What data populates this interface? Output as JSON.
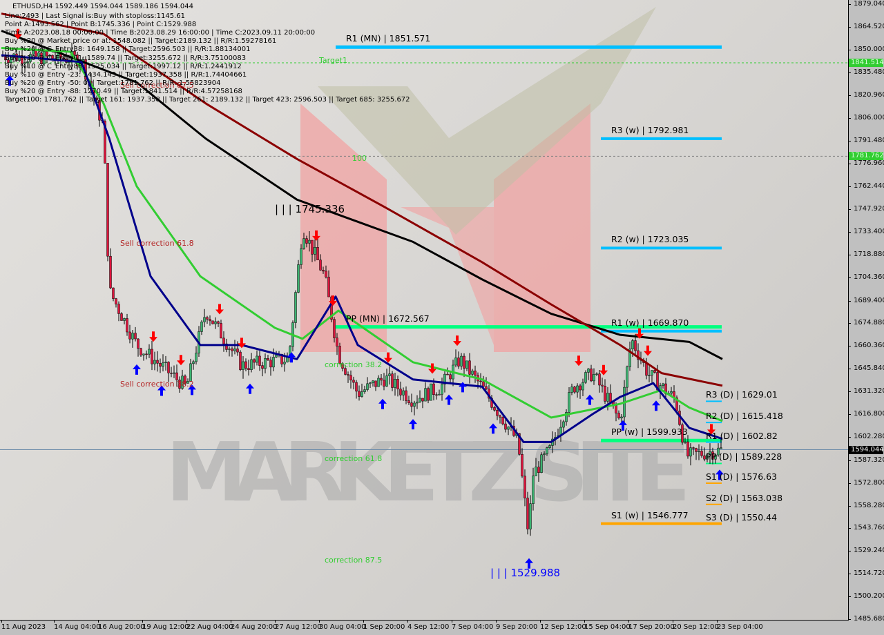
{
  "header": {
    "symbol_line": "ETHUSD,H4  1592.449 1594.044 1589.186 1594.044",
    "info_lines": [
      "Line:2493 | Last Signal is:Buy with stoploss:1145.61",
      "Point A:1493.562 | Point B:1745.336 | Point C:1529.988",
      "Time A:2023.08.18 00:00:00 | Time B:2023.08.29 16:00:00 | Time C:2023.09.11 20:00:00",
      "Buy %20 @ Market price or at: 1548.082 || Target:2189.132 || R/R:1.59278161",
      "Buy %20 @ C_Entry38: 1649.158 || Target:2596.503 || R/R:1.88134001",
      "Buy %10 @ C_Entry61: 1589.74 || Target:3255.672 || R/R:3.75100083",
      "Buy %10 @ C_Entry88: 1525.034 || Target:1997.12 || R/R:1.2441912",
      "Buy %10 @ Entry -23: 1434.143 || Target:1937.358 || R/R:1.74404661",
      "Buy %20 @ Entry -50: 0 || Target:1781.762 || R/R:-1.55823904",
      "Buy %20 @ Entry -88: 1270.49 || Target:1841.514 || R/R:4.57258168",
      "Target100: 1781.762 || Target 161: 1937.358 || Target 261: 2189.132 || Target 423: 2596.503 || Target 685: 3255.672"
    ]
  },
  "watermark": "MARKETZ SITE",
  "colors": {
    "black_ma": "#000000",
    "maroon_ma": "#8b0000",
    "green_ma": "#32cd32",
    "navy_ma": "#00008b",
    "level_blue": "#00bfff",
    "level_green": "#00ff7f",
    "level_orange": "#ffa500",
    "bull": "#3cb371",
    "bear": "#dc143c",
    "buy_arrow": "#0000ff",
    "sell_arrow": "#ff0000"
  },
  "chart_data": {
    "type": "candlestick",
    "symbol": "ETHUSD",
    "timeframe": "H4",
    "ylim": [
      1485.68,
      1879.04
    ],
    "y_ticks": [
      "1879.040",
      "1864.520",
      "1850.000",
      "1835.480",
      "1820.960",
      "1806.000",
      "1791.480",
      "1776.960",
      "1762.440",
      "1747.920",
      "1733.400",
      "1718.880",
      "1704.360",
      "1689.400",
      "1674.880",
      "1660.360",
      "1645.840",
      "1631.320",
      "1616.800",
      "1602.280",
      "1587.320",
      "1572.800",
      "1558.280",
      "1543.760",
      "1529.240",
      "1514.720",
      "1500.200",
      "1485.680"
    ],
    "x_ticks": [
      {
        "label": "11 Aug 2023",
        "t": "2023-08-11T00:00"
      },
      {
        "label": "14 Aug 04:00",
        "t": "2023-08-14T04:00"
      },
      {
        "label": "16 Aug 20:00",
        "t": "2023-08-16T20:00"
      },
      {
        "label": "19 Aug 12:00",
        "t": "2023-08-19T12:00"
      },
      {
        "label": "22 Aug 04:00",
        "t": "2023-08-22T04:00"
      },
      {
        "label": "24 Aug 20:00",
        "t": "2023-08-24T20:00"
      },
      {
        "label": "27 Aug 12:00",
        "t": "2023-08-27T12:00"
      },
      {
        "label": "30 Aug 04:00",
        "t": "2023-08-30T04:00"
      },
      {
        "label": "1 Sep 20:00",
        "t": "2023-09-01T20:00"
      },
      {
        "label": "4 Sep 12:00",
        "t": "2023-09-04T12:00"
      },
      {
        "label": "7 Sep 04:00",
        "t": "2023-09-07T04:00"
      },
      {
        "label": "9 Sep 20:00",
        "t": "2023-09-09T20:00"
      },
      {
        "label": "12 Sep 12:00",
        "t": "2023-09-12T12:00"
      },
      {
        "label": "15 Sep 04:00",
        "t": "2023-09-15T04:00"
      },
      {
        "label": "17 Sep 20:00",
        "t": "2023-09-17T20:00"
      },
      {
        "label": "20 Sep 12:00",
        "t": "2023-09-20T12:00"
      },
      {
        "label": "23 Sep 04:00",
        "t": "2023-09-23T04:00"
      }
    ],
    "current_price": "1594.044",
    "price_tags": [
      {
        "value": "1841.514",
        "color": "#32cd32"
      },
      {
        "value": "1781.762",
        "color": "#32cd32"
      }
    ],
    "close": [
      [
        "2023-08-11T00:00",
        1846
      ],
      [
        "2023-08-15T20:00",
        1844
      ],
      [
        "2023-08-17T04:00",
        1800
      ],
      [
        "2023-08-17T12:00",
        1696
      ],
      [
        "2023-08-19T04:00",
        1661
      ],
      [
        "2023-08-22T04:00",
        1634
      ],
      [
        "2023-08-23T08:00",
        1683
      ],
      [
        "2023-08-25T12:00",
        1648
      ],
      [
        "2023-08-28T08:00",
        1652
      ],
      [
        "2023-08-29T04:00",
        1736
      ],
      [
        "2023-08-30T12:00",
        1705
      ],
      [
        "2023-08-31T08:00",
        1655
      ],
      [
        "2023-09-01T12:00",
        1630
      ],
      [
        "2023-09-03T04:00",
        1640
      ],
      [
        "2023-09-04T20:00",
        1626
      ],
      [
        "2023-09-06T12:00",
        1634
      ],
      [
        "2023-09-07T16:00",
        1652
      ],
      [
        "2023-09-09T00:00",
        1634
      ],
      [
        "2023-09-11T04:00",
        1599
      ],
      [
        "2023-09-11T20:00",
        1537
      ],
      [
        "2023-09-12T00:00",
        1577
      ],
      [
        "2023-09-13T04:00",
        1595
      ],
      [
        "2023-09-14T12:00",
        1634
      ],
      [
        "2023-09-15T16:00",
        1643
      ],
      [
        "2023-09-17T08:00",
        1612
      ],
      [
        "2023-09-18T00:00",
        1665
      ],
      [
        "2023-09-19T00:00",
        1643
      ],
      [
        "2023-09-20T16:00",
        1626
      ],
      [
        "2023-09-21T08:00",
        1590
      ],
      [
        "2023-09-23T12:00",
        1594
      ]
    ],
    "moving_averages": [
      {
        "color": "#000000",
        "points": [
          [
            "2023-08-11T00:00",
            1862
          ],
          [
            "2023-08-19T04:00",
            1829
          ],
          [
            "2023-08-23T08:00",
            1793
          ],
          [
            "2023-08-28T20:00",
            1754
          ],
          [
            "2023-09-04T20:00",
            1727
          ],
          [
            "2023-09-09T00:00",
            1703
          ],
          [
            "2023-09-13T04:00",
            1681
          ],
          [
            "2023-09-17T08:00",
            1667.5
          ],
          [
            "2023-09-21T12:00",
            1663
          ],
          [
            "2023-09-23T12:00",
            1652
          ]
        ]
      },
      {
        "color": "#8b0000",
        "points": [
          [
            "2023-08-11T00:00",
            1873
          ],
          [
            "2023-08-17T04:00",
            1860
          ],
          [
            "2023-08-23T08:00",
            1815.5
          ],
          [
            "2023-08-28T20:00",
            1780
          ],
          [
            "2023-09-03T04:00",
            1749
          ],
          [
            "2023-09-09T00:00",
            1714
          ],
          [
            "2023-09-13T04:00",
            1687
          ],
          [
            "2023-09-17T08:00",
            1661
          ],
          [
            "2023-09-19T20:00",
            1643
          ],
          [
            "2023-09-23T12:00",
            1635
          ]
        ]
      },
      {
        "color": "#32cd32",
        "points": [
          [
            "2023-08-11T00:00",
            1851
          ],
          [
            "2023-08-15T04:00",
            1848.6
          ],
          [
            "2023-08-17T04:00",
            1815.5
          ],
          [
            "2023-08-19T04:00",
            1762.5
          ],
          [
            "2023-08-23T00:00",
            1705
          ],
          [
            "2023-08-27T12:00",
            1672
          ],
          [
            "2023-08-29T04:00",
            1665
          ],
          [
            "2023-08-31T08:00",
            1683
          ],
          [
            "2023-09-04T20:00",
            1650
          ],
          [
            "2023-09-09T00:00",
            1639
          ],
          [
            "2023-09-13T04:00",
            1614.6
          ],
          [
            "2023-09-17T08:00",
            1623.4
          ],
          [
            "2023-09-19T20:00",
            1632.2
          ],
          [
            "2023-09-21T12:00",
            1621
          ],
          [
            "2023-09-23T12:00",
            1612.4
          ]
        ]
      },
      {
        "color": "#00008b",
        "points": [
          [
            "2023-08-11T00:00",
            1846.4
          ],
          [
            "2023-08-15T20:00",
            1842
          ],
          [
            "2023-08-17T12:00",
            1793.4
          ],
          [
            "2023-08-20T00:00",
            1705
          ],
          [
            "2023-08-23T00:00",
            1661
          ],
          [
            "2023-08-25T12:00",
            1661
          ],
          [
            "2023-08-28T20:00",
            1652
          ],
          [
            "2023-08-31T04:00",
            1692
          ],
          [
            "2023-09-01T12:00",
            1661
          ],
          [
            "2023-09-04T20:00",
            1639
          ],
          [
            "2023-09-09T00:00",
            1634.4
          ],
          [
            "2023-09-11T12:00",
            1599
          ],
          [
            "2023-09-13T04:00",
            1599
          ],
          [
            "2023-09-15T16:00",
            1616.8
          ],
          [
            "2023-09-17T08:00",
            1627.8
          ],
          [
            "2023-09-19T08:00",
            1636.6
          ],
          [
            "2023-09-21T12:00",
            1608
          ],
          [
            "2023-09-23T12:00",
            1601
          ]
        ]
      }
    ],
    "levels": [
      {
        "label": "R1 (MN) | 1851.571",
        "value": 1851.571,
        "color": "#00bfff",
        "from": "2023-08-31T04:00"
      },
      {
        "label": "R3 (w) | 1792.981",
        "value": 1792.981,
        "color": "#00bfff",
        "from": "2023-09-16T04:00"
      },
      {
        "label": "R2 (w) | 1723.035",
        "value": 1723.035,
        "color": "#00bfff",
        "from": "2023-09-16T04:00"
      },
      {
        "label": "PP (MN) | 1672.567",
        "value": 1672.567,
        "color": "#00ff7f",
        "from": "2023-08-31T04:00"
      },
      {
        "label": "R1 (w) | 1669.870",
        "value": 1669.87,
        "color": "#00bfff",
        "from": "2023-09-16T04:00"
      },
      {
        "label": "PP (w) | 1599.933",
        "value": 1599.933,
        "color": "#00ff7f",
        "from": "2023-09-16T04:00"
      },
      {
        "label": "S1 (w) | 1546.777",
        "value": 1546.777,
        "color": "#ffa500",
        "from": "2023-09-16T04:00"
      },
      {
        "label": "R3 (D) | 1629.01",
        "value": 1629.01,
        "color": "#00bfff",
        "from": "2023-09-22T12:00"
      },
      {
        "label": "R2 (D) | 1615.418",
        "value": 1615.418,
        "color": "#00bfff",
        "from": "2023-09-22T12:00"
      },
      {
        "label": "R1 (D) | 1602.82",
        "value": 1602.82,
        "color": "#00bfff",
        "from": "2023-09-22T12:00"
      },
      {
        "label": "PP (D) | 1589.228",
        "value": 1589.228,
        "color": "#00ff7f",
        "from": "2023-09-22T12:00"
      },
      {
        "label": "S1 (D) | 1576.63",
        "value": 1576.63,
        "color": "#ffa500",
        "from": "2023-09-22T12:00"
      },
      {
        "label": "S2 (D) | 1563.038",
        "value": 1563.038,
        "color": "#ffa500",
        "from": "2023-09-22T12:00"
      },
      {
        "label": "S3 (D) | 1550.44",
        "value": 1550.44,
        "color": "#ffa500",
        "from": "2023-09-22T12:00"
      }
    ],
    "target_lines": [
      {
        "value": 1841.514,
        "color": "#32cd32"
      },
      {
        "value": 1781.762,
        "color": "#808080"
      }
    ],
    "annotations": [
      {
        "text": "Target1",
        "color": "#32cd32",
        "t": "2023-08-30T04:00",
        "value": 1843
      },
      {
        "text": "| | | 1745.336",
        "color": "#000000",
        "t": "2023-08-27T12:00",
        "value": 1749
      },
      {
        "text": "100",
        "color": "#32cd32",
        "t": "2023-09-01T04:00",
        "value": 1780
      },
      {
        "text": "Sell correction 87.5",
        "color": "#b22222",
        "t": "2023-08-18T04:00",
        "value": 1827
      },
      {
        "text": "Sell correction 61.8",
        "color": "#b22222",
        "t": "2023-08-18T04:00",
        "value": 1726
      },
      {
        "text": "Sell correction 38.2",
        "color": "#b22222",
        "t": "2023-08-18T04:00",
        "value": 1636
      },
      {
        "text": "correction 38.2",
        "color": "#32cd32",
        "t": "2023-08-30T12:00",
        "value": 1648
      },
      {
        "text": "correction 61.8",
        "color": "#32cd32",
        "t": "2023-08-30T12:00",
        "value": 1588
      },
      {
        "text": "correction 87.5",
        "color": "#32cd32",
        "t": "2023-08-30T12:00",
        "value": 1523
      },
      {
        "text": "| | | 1529.988",
        "color": "#0000ff",
        "t": "2023-09-09T12:00",
        "value": 1516
      }
    ],
    "buy_signals": [
      "2023-08-11T12:00",
      "2023-08-19T04:00",
      "2023-08-20T16:00",
      "2023-08-22T12:00",
      "2023-08-26T00:00",
      "2023-08-28T12:00",
      "2023-09-03T00:00",
      "2023-09-04T20:00",
      "2023-09-07T00:00",
      "2023-09-07T20:00",
      "2023-09-09T16:00",
      "2023-09-11T20:00",
      "2023-09-15T12:00",
      "2023-09-17T12:00",
      "2023-09-19T12:00",
      "2023-09-23T08:00"
    ],
    "sell_signals": [
      "2023-08-12T00:00",
      "2023-08-20T04:00",
      "2023-08-21T20:00",
      "2023-08-24T04:00",
      "2023-08-25T12:00",
      "2023-08-30T00:00",
      "2023-08-31T00:00",
      "2023-09-03T08:00",
      "2023-09-06T00:00",
      "2023-09-07T12:00",
      "2023-09-14T20:00",
      "2023-09-16T08:00",
      "2023-09-18T12:00",
      "2023-09-19T00:00",
      "2023-09-22T20:00"
    ]
  }
}
